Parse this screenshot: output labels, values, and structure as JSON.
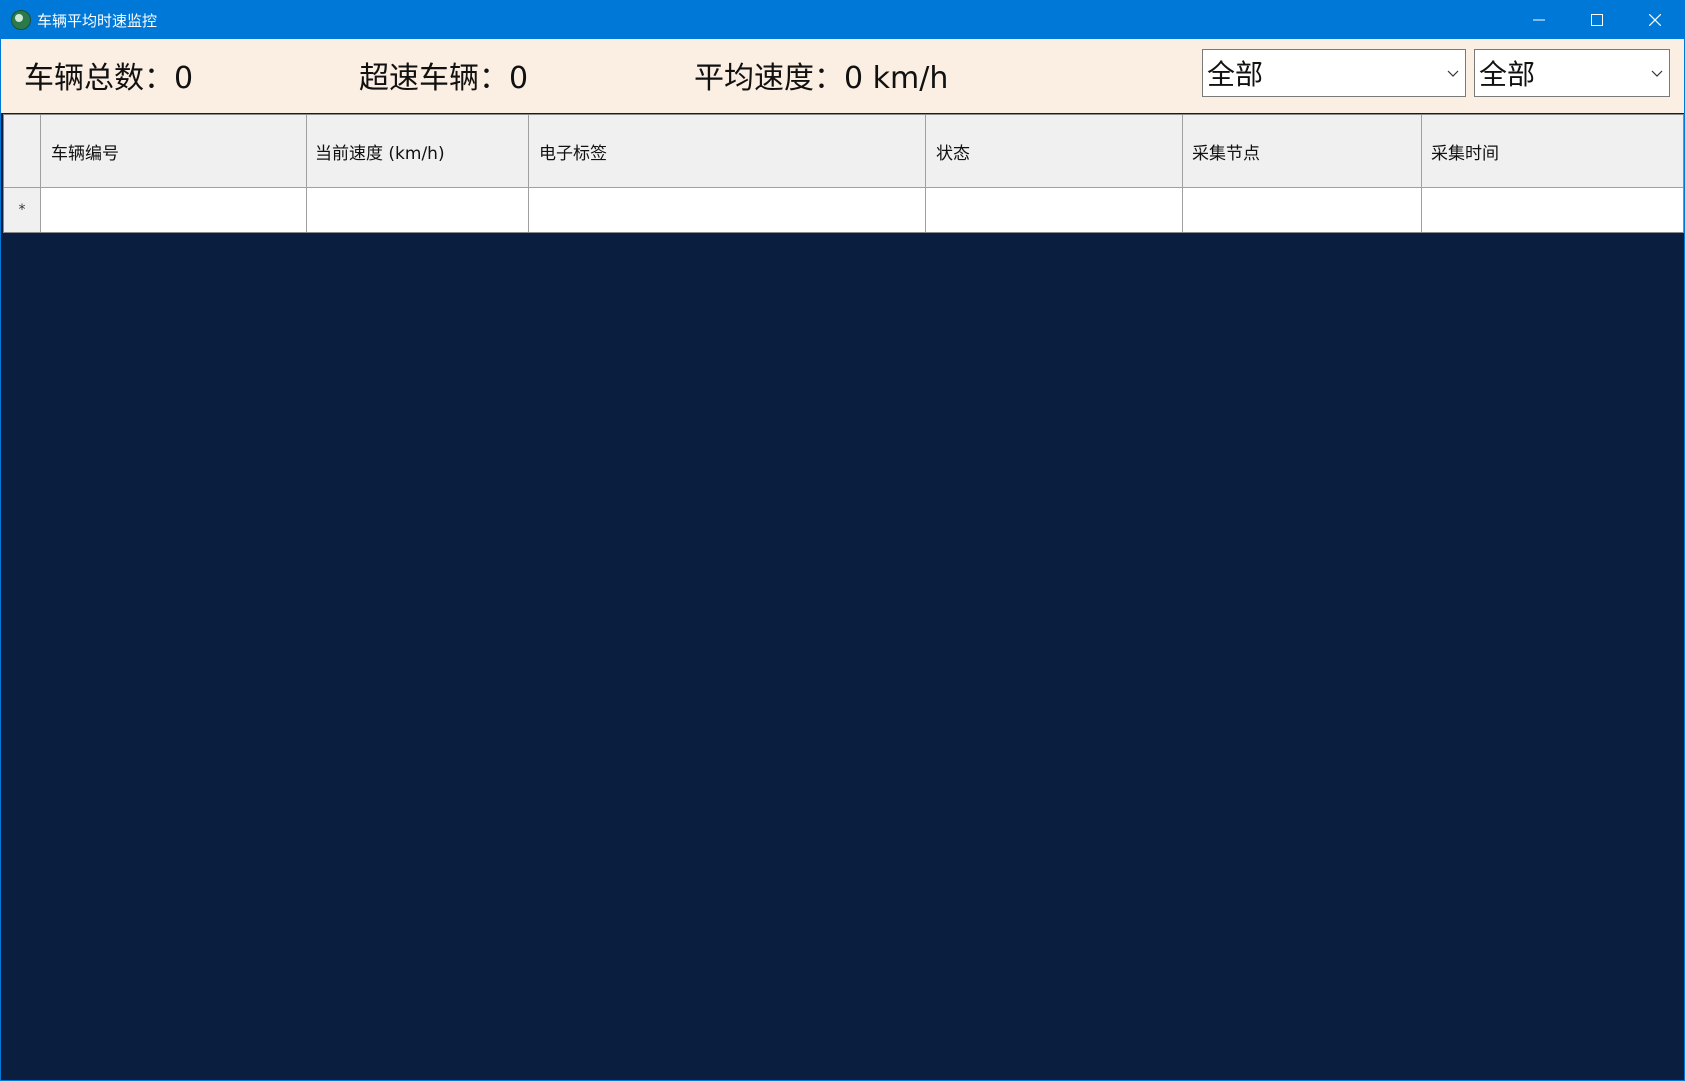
{
  "window": {
    "title": "车辆平均时速监控"
  },
  "stats": {
    "total_label": "车辆总数：0",
    "speeding_label": "超速车辆：0",
    "avg_label": "平均速度：0 km/h"
  },
  "filters": {
    "select1_value": "全部",
    "select2_value": "全部"
  },
  "table": {
    "columns": [
      "车辆编号",
      "当前速度 (km/h)",
      "电子标签",
      "状态",
      "采集节点",
      "采集时间"
    ],
    "new_row_marker": "*"
  },
  "colors": {
    "titlebar": "#0078d7",
    "infobar": "#fbefe4",
    "background": "#0a1f3f"
  }
}
